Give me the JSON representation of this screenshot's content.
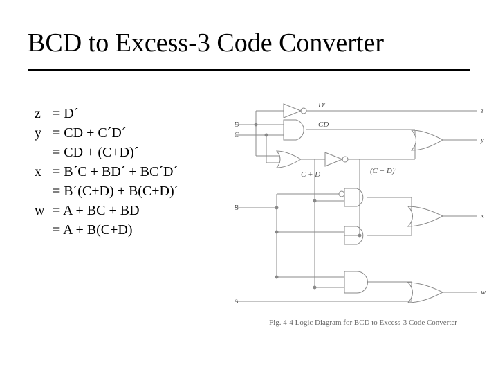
{
  "title": "BCD to Excess-3 Code Converter",
  "equations": {
    "z": {
      "lines": [
        "= D´"
      ]
    },
    "y": {
      "lines": [
        "= CD + C´D´",
        "= CD + (C+D)´"
      ]
    },
    "x": {
      "lines": [
        "= B´C + BD´ + BC´D´",
        "= B´(C+D) + B(C+D)´"
      ]
    },
    "w": {
      "lines": [
        "= A + BC + BD",
        "= A + B(C+D)"
      ]
    }
  },
  "inputs": {
    "D": "D",
    "C": "C",
    "B": "B",
    "A": "A"
  },
  "signals": {
    "Dp": "D'",
    "CD": "CD",
    "CplusD": "C + D",
    "CplusDp": "(C + D)'"
  },
  "outputs": {
    "z": "z",
    "y": "y",
    "x": "x",
    "w": "w"
  },
  "caption": "Fig. 4-4  Logic Diagram for BCD to Excess-3 Code Converter"
}
